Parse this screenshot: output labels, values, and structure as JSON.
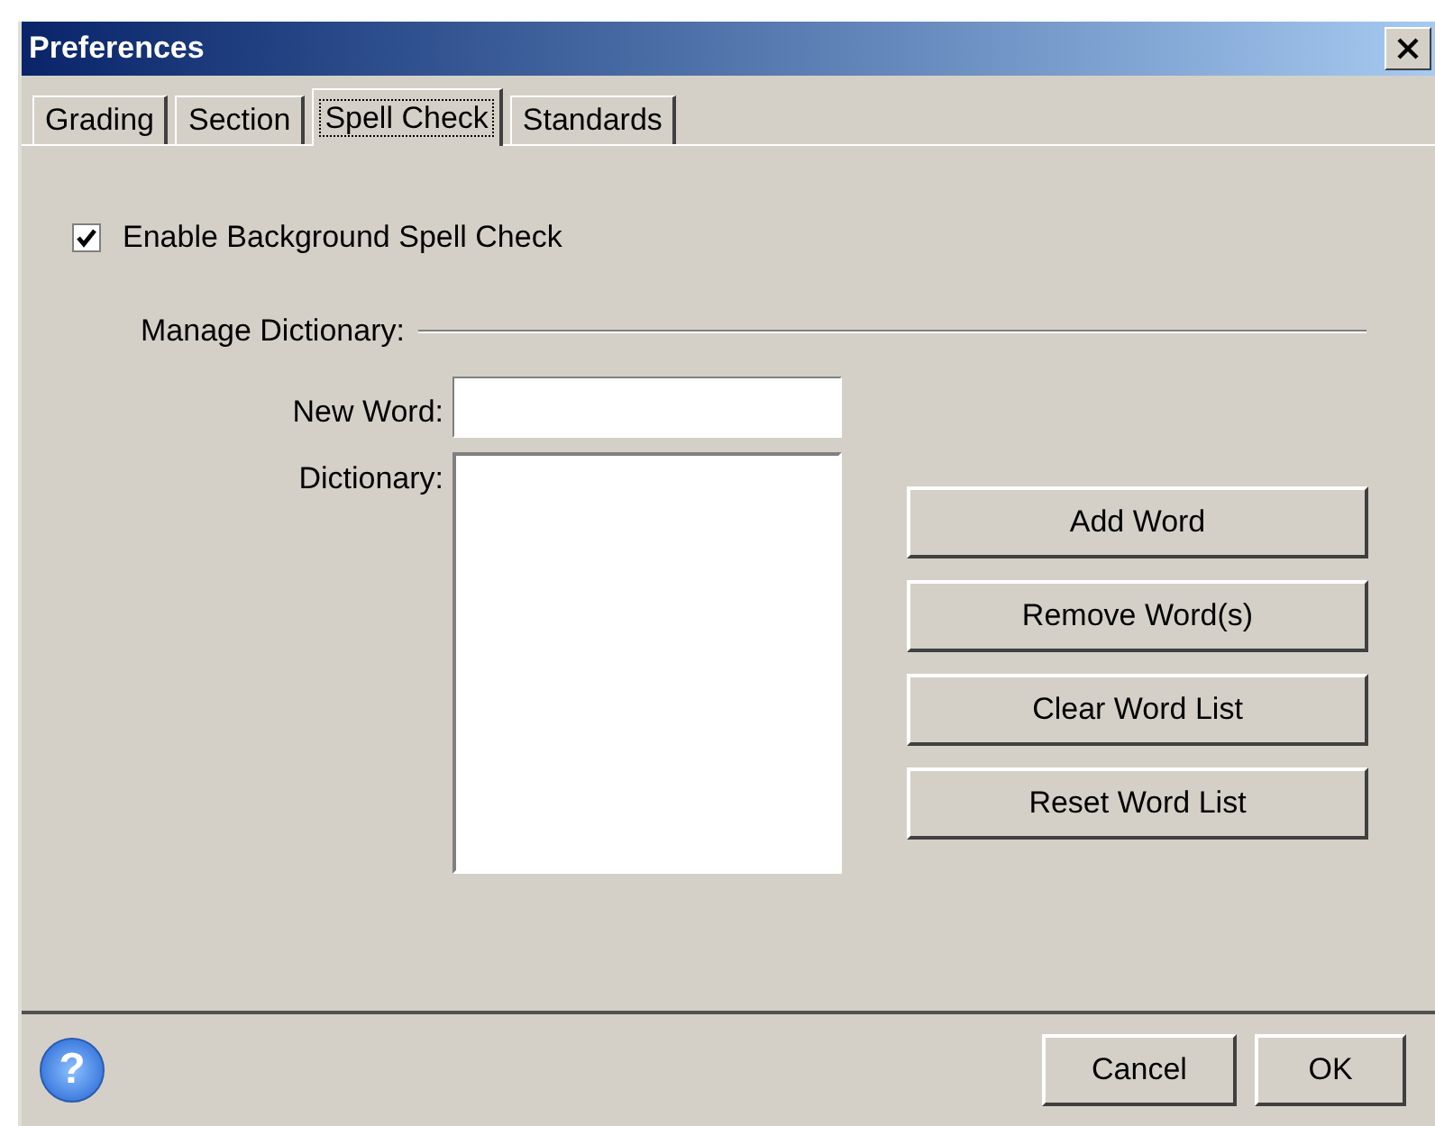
{
  "window": {
    "title": "Preferences"
  },
  "tabs": [
    {
      "label": "Grading",
      "selected": false
    },
    {
      "label": "Section",
      "selected": false
    },
    {
      "label": "Spell Check",
      "selected": true
    },
    {
      "label": "Standards",
      "selected": false
    }
  ],
  "enable_spell_check": {
    "label": "Enable Background Spell Check",
    "checked": true
  },
  "manage_dictionary": {
    "heading": "Manage Dictionary:",
    "new_word_label": "New Word:",
    "dictionary_label": "Dictionary:"
  },
  "actions": [
    "Add Word",
    "Remove Word(s)",
    "Clear Word List",
    "Reset Word List"
  ],
  "help_button": {
    "label": "?"
  },
  "buttons": [
    "Cancel",
    "OK"
  ]
}
